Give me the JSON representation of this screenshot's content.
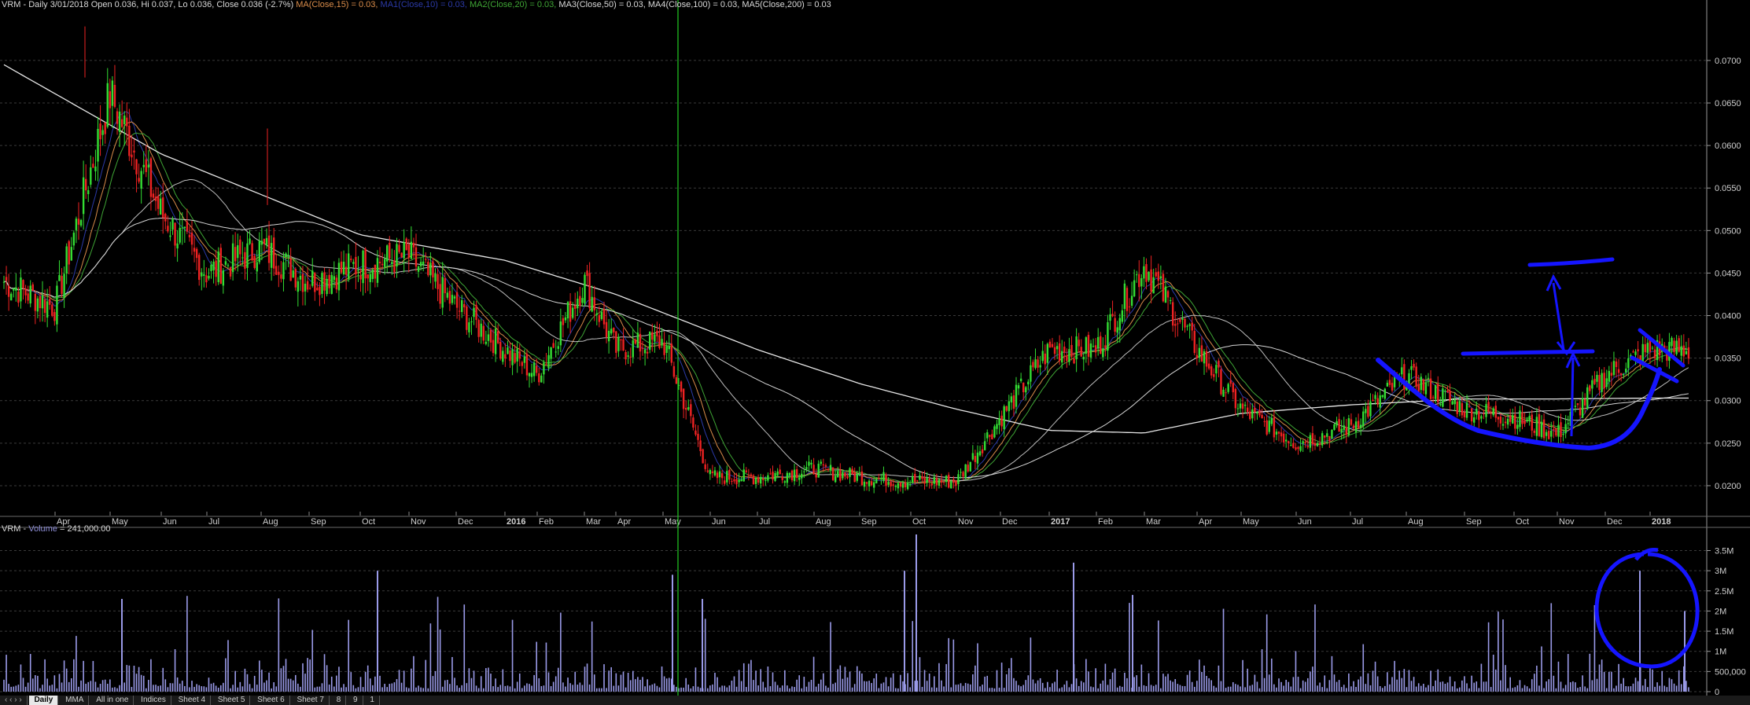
{
  "price_header": {
    "prefix": "VRM - Daily 3/01/2018 Open 0.036, Hi 0.037, Lo 0.036, Close 0.036 (-2.7%)",
    "ma1": "MA(Close,15) = 0.03,",
    "ma2": "MA1(Close,10) = 0.03,",
    "ma3": "MA2(Close,20) = 0.03,",
    "ma4": "MA3(Close,50) = 0.03, MA4(Close,100) = 0.03, MA5(Close,200) = 0.03",
    "ma1_color": "#d98c4a",
    "ma2_color": "#2b3aa8",
    "ma3_color": "#3fa535",
    "ma4_color": "#d8d8d8"
  },
  "volume_header": {
    "prefix": "VRM -",
    "label": "Volume",
    "suffix": "= 241,000.00",
    "label_color": "#8f8fd8"
  },
  "tabs": {
    "arrows": "‹ ‹ › ›",
    "items": [
      "Daily",
      "MMA",
      "All in one",
      "Indices",
      "Sheet 4",
      "Sheet 5",
      "Sheet 6",
      "Sheet 7",
      "8",
      "9",
      "1"
    ],
    "active": "Daily"
  },
  "colors": {
    "background": "#000000",
    "up_candle": "#33dd33",
    "down_candle": "#ee2222",
    "volume_bar": "#9a9ae8",
    "grid": "#3a3a3a",
    "cursor_line": "#22cc22",
    "annotation": "#1515ff",
    "ma_long": "#e6e6e6"
  },
  "chart_data": [
    {
      "type": "candlestick",
      "title": "VRM - Daily",
      "ylim": [
        0.0175,
        0.076
      ],
      "y_ticks": [
        0.02,
        0.025,
        0.03,
        0.035,
        0.04,
        0.045,
        0.05,
        0.055,
        0.06,
        0.065,
        0.07
      ],
      "y_tick_labels": [
        "0.0200",
        "0.0250",
        "0.0300",
        "0.0350",
        "0.0400",
        "0.0450",
        "0.0500",
        "0.0550",
        "0.0600",
        "0.0650",
        "0.0700"
      ],
      "x_labels": [
        "Apr",
        "May",
        "Jun",
        "Jul",
        "Aug",
        "Sep",
        "Oct",
        "Nov",
        "Dec",
        "2016",
        "Feb",
        "Mar",
        "Apr",
        "May",
        "Jun",
        "Jul",
        "Aug",
        "Sep",
        "Oct",
        "Nov",
        "Dec",
        "2017",
        "Feb",
        "Mar",
        "Apr",
        "May",
        "Jun",
        "Jul",
        "Aug",
        "Sep",
        "Oct",
        "Nov",
        "Dec",
        "2018"
      ],
      "x_label_bold": [
        "2016",
        "2017",
        "2018"
      ],
      "close_path": [
        [
          "Mar",
          0.044
        ],
        [
          "Apr",
          0.041
        ],
        [
          "May",
          0.066
        ],
        [
          "Jun",
          0.052
        ],
        [
          "Jul",
          0.045
        ],
        [
          "Aug",
          0.048
        ],
        [
          "Sep",
          0.044
        ],
        [
          "Oct",
          0.046
        ],
        [
          "Nov",
          0.047
        ],
        [
          "Dec",
          0.041
        ],
        [
          "2016",
          0.036
        ],
        [
          "Feb",
          0.033
        ],
        [
          "Mar",
          0.044
        ],
        [
          "Apr",
          0.036
        ],
        [
          "May",
          0.037
        ],
        [
          "Jun",
          0.021
        ],
        [
          "Jul",
          0.021
        ],
        [
          "Aug",
          0.022
        ],
        [
          "Sep",
          0.021
        ],
        [
          "Oct",
          0.0205
        ],
        [
          "Nov",
          0.0205
        ],
        [
          "Dec",
          0.028
        ],
        [
          "2017",
          0.036
        ],
        [
          "Feb",
          0.036
        ],
        [
          "Mar",
          0.046
        ],
        [
          "Apr",
          0.036
        ],
        [
          "May",
          0.029
        ],
        [
          "Jun",
          0.025
        ],
        [
          "Jul",
          0.027
        ],
        [
          "Aug",
          0.033
        ],
        [
          "Sep",
          0.029
        ],
        [
          "Oct",
          0.028
        ],
        [
          "Nov",
          0.026
        ],
        [
          "Dec",
          0.033
        ],
        [
          "2018",
          0.036
        ]
      ],
      "ma200_path": [
        [
          "Mar",
          0.0695
        ],
        [
          "Jun",
          0.059
        ],
        [
          "Oct",
          0.0495
        ],
        [
          "2016",
          0.0465
        ],
        [
          "Apr",
          0.0425
        ],
        [
          "Jul",
          0.036
        ],
        [
          "Sep",
          0.032
        ],
        [
          "Nov",
          0.029
        ],
        [
          "2017",
          0.0265
        ],
        [
          "Mar",
          0.0262
        ],
        [
          "May",
          0.0285
        ],
        [
          "Jul",
          0.0295
        ],
        [
          "Sep",
          0.0302
        ],
        [
          "Nov",
          0.0302
        ],
        [
          "2018",
          0.0303
        ]
      ],
      "cursor_x_label": "May",
      "annotations": [
        "cup-curve",
        "resistance-line",
        "target-line",
        "arrow-up",
        "wedge-lines"
      ]
    },
    {
      "type": "bar",
      "title": "Volume",
      "ylim": [
        0,
        3900000
      ],
      "y_ticks": [
        0,
        500000,
        1000000,
        1500000,
        2000000,
        2500000,
        3000000,
        3500000
      ],
      "y_tick_labels": [
        "0",
        "500,000",
        "1M",
        "1.5M",
        "2M",
        "2.5M",
        "3M",
        "3.5M"
      ],
      "notable_spikes": [
        [
          "May",
          2300000
        ],
        [
          "Oct",
          3000000
        ],
        [
          "May",
          2900000
        ],
        [
          "Jun",
          2300000
        ],
        [
          "Oct",
          3000000
        ],
        [
          "Nov",
          3900000
        ],
        [
          "Mar",
          3200000
        ],
        [
          "Jun",
          2400000
        ],
        [
          "Dec",
          3000000
        ],
        [
          "2018",
          2000000
        ]
      ],
      "annotations": [
        "volume-circle"
      ]
    }
  ]
}
